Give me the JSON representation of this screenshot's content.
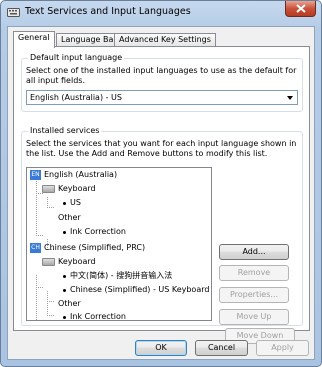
{
  "window": {
    "title": "Text Services and Input Languages"
  },
  "tabs": [
    {
      "label": "General"
    },
    {
      "label": "Language Bar"
    },
    {
      "label": "Advanced Key Settings"
    }
  ],
  "default_language": {
    "group_label": "Default input language",
    "description": "Select one of the installed input languages to use as the default for all input fields.",
    "selected": "English (Australia) - US"
  },
  "installed_services": {
    "group_label": "Installed services",
    "description": "Select the services that you want for each input language shown in the list. Use the Add and Remove buttons to modify this list.",
    "tree": {
      "lang1": {
        "badge": "EN",
        "label": "English (Australia)"
      },
      "lang1_keyboard": "Keyboard",
      "lang1_kb_item": "US",
      "lang1_other": "Other",
      "lang1_other_item": "Ink Correction",
      "lang2": {
        "badge": "CH",
        "label": "Chinese (Simplified, PRC)"
      },
      "lang2_keyboard": "Keyboard",
      "lang2_kb_item1": "中文(简体) - 搜狗拼音输入法",
      "lang2_kb_item2": "Chinese (Simplified) - US Keyboard",
      "lang2_other": "Other",
      "lang2_other_item": "Ink Correction"
    },
    "buttons": {
      "add": "Add...",
      "remove": "Remove",
      "properties": "Properties...",
      "move_up": "Move Up",
      "move_down": "Move Down"
    }
  },
  "footer": {
    "ok": "OK",
    "cancel": "Cancel",
    "apply": "Apply"
  },
  "colors": {
    "lang_badge": "#3a7bd5",
    "close_button": "#c9523a"
  }
}
